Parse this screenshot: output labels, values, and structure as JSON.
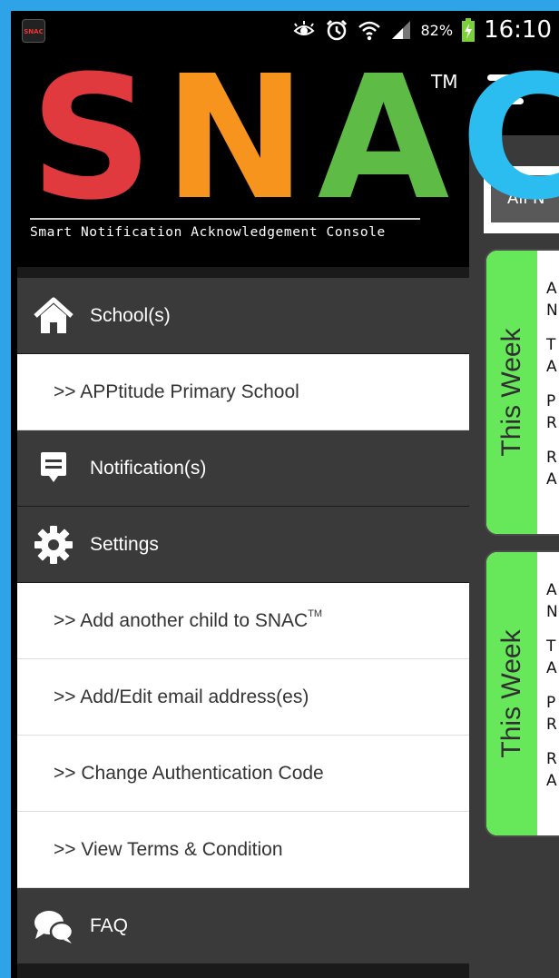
{
  "status_bar": {
    "battery_percent": "82%",
    "time": "16:10",
    "app_icon_text": "SNAC"
  },
  "logo": {
    "letters": [
      {
        "char": "S",
        "color": "#e03a3e"
      },
      {
        "char": "N",
        "color": "#f7941d"
      },
      {
        "char": "A",
        "color": "#5dbb46"
      },
      {
        "char": "C",
        "color": "#2bbcf0"
      }
    ],
    "trademark": "TM",
    "tagline": "Smart Notification Acknowledgement Console"
  },
  "drawer_menu": {
    "school_label": "School(s)",
    "school_items": [
      ">> APPtitude Primary School"
    ],
    "notification_label": "Notification(s)",
    "settings_label": "Settings",
    "settings_items": {
      "add_child_label": ">> Add another child to SNAC",
      "add_child_tm": "TM",
      "edit_email_label": ">> Add/Edit email address(es)",
      "change_auth_label": ">> Change Authentication Code",
      "view_terms_label": ">> View Terms & Condition"
    },
    "faq_label": "FAQ"
  },
  "main": {
    "filter_button_label": "All N",
    "cards": [
      {
        "tab_label": "This Week",
        "lines": [
          [
            "A",
            "N"
          ],
          [
            "T",
            "A"
          ],
          [
            "P",
            "R"
          ],
          [
            "R",
            "A"
          ]
        ]
      },
      {
        "tab_label": "This Week",
        "lines": [
          [
            "A",
            "N"
          ],
          [
            "T",
            "A"
          ],
          [
            "P",
            "R"
          ],
          [
            "R",
            "A"
          ]
        ]
      }
    ]
  },
  "colors": {
    "frame_background": "#2ea3e8",
    "drawer_dark_item": "#3a3a3a",
    "week_tab_green": "#66e85a"
  }
}
